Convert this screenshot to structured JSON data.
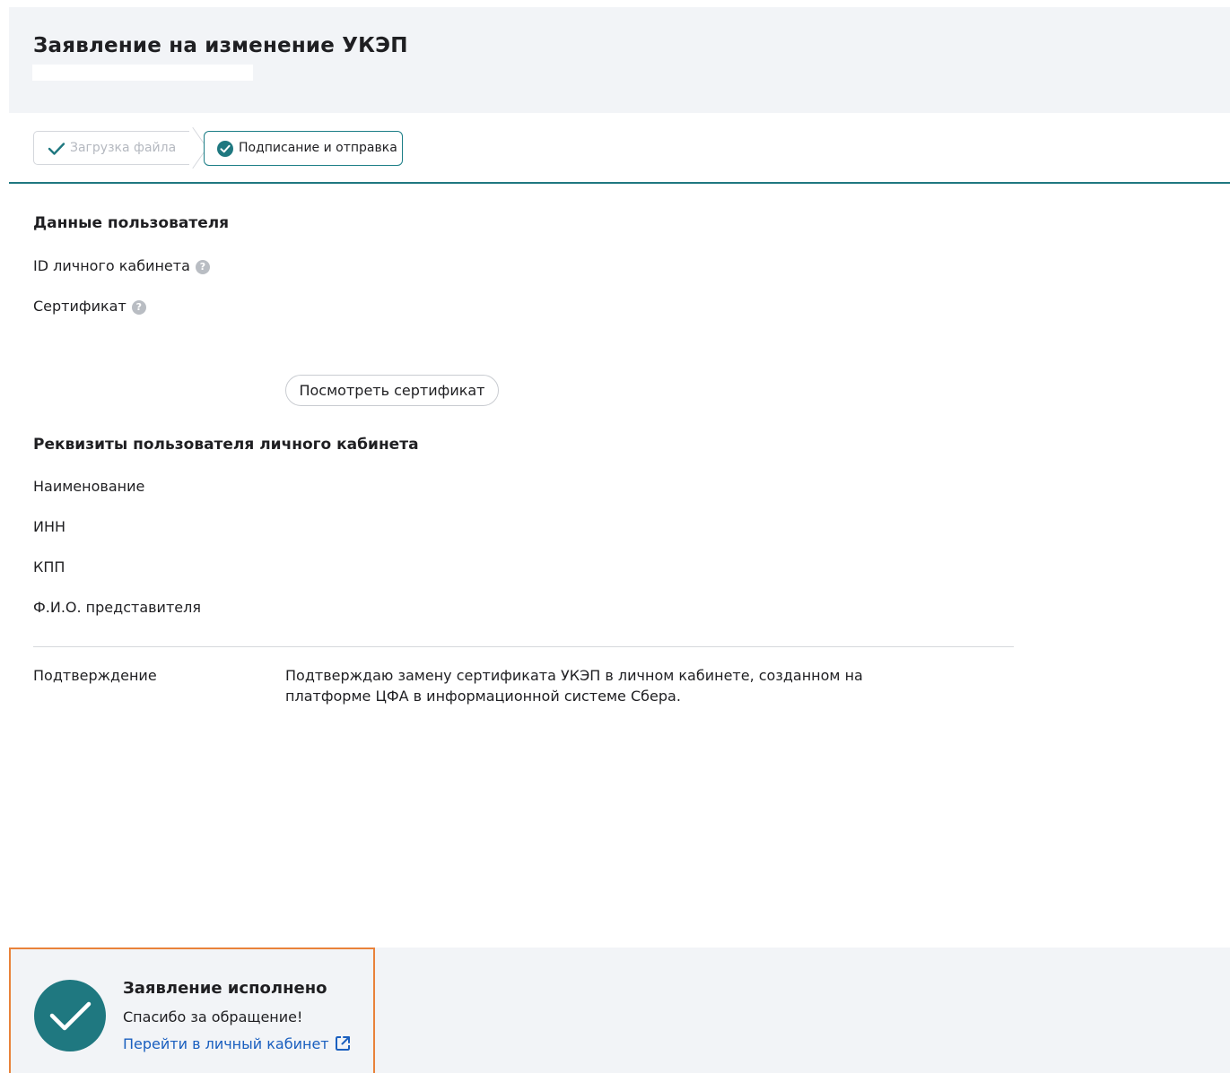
{
  "header": {
    "title": "Заявление на изменение УКЭП"
  },
  "stepper": {
    "steps": [
      {
        "label": "Загрузка файла",
        "state": "done"
      },
      {
        "label": "Подписание и отправка",
        "state": "active"
      }
    ]
  },
  "user_data": {
    "title": "Данные пользователя",
    "fields": [
      {
        "label": "ID личного кабинета",
        "help": "?"
      },
      {
        "label": "Сертификат",
        "help": "?"
      }
    ],
    "view_certificate_button": "Посмотреть сертификат"
  },
  "requisites": {
    "title": "Реквизиты пользователя личного кабинета",
    "fields": [
      {
        "label": "Наименование"
      },
      {
        "label": "ИНН"
      },
      {
        "label": "КПП"
      },
      {
        "label": "Ф.И.О. представителя"
      }
    ]
  },
  "confirmation": {
    "label": "Подтверждение",
    "text": "Подтверждаю замену сертификата УКЭП в личном кабинете, созданном на платформе ЦФА в информационной системе Сбера."
  },
  "notice": {
    "title": "Заявление исполнено",
    "subtitle": "Спасибо за обращение!",
    "link": "Перейти в личный кабинет"
  },
  "colors": {
    "accent": "#1f7880",
    "link": "#1a5fbf",
    "highlight": "#e9823a",
    "panel": "#f2f4f7"
  }
}
